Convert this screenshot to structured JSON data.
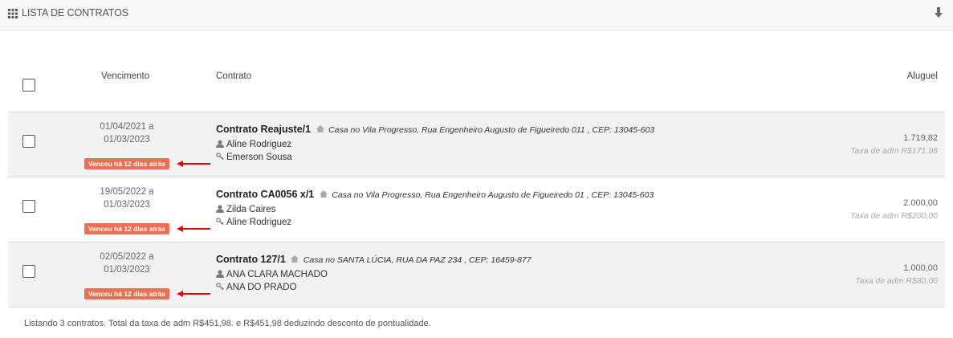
{
  "panel": {
    "title": "LISTA DE CONTRATOS",
    "title_icon": "grid-icon",
    "download_icon": "download-arrow-icon"
  },
  "table": {
    "headers": {
      "vencimento": "Vencimento",
      "contrato": "Contrato",
      "aluguel": "Aluguel"
    },
    "rows": [
      {
        "date_start": "01/04/2021 a",
        "date_end": "01/03/2023",
        "badge": "Venceu há 12 dias atrás",
        "title": "Contrato Reajuste/1",
        "address": "Casa no Vila Progresso, Rua Engenheiro Augusto de Figueiredo 011 , CEP: 13045-603",
        "owner": "Aline Rodriguez",
        "tenant": "Emerson Sousa",
        "valor": "1.719,82",
        "taxa": "Taxa de adm R$171,98"
      },
      {
        "date_start": "19/05/2022 a",
        "date_end": "01/03/2023",
        "badge": "Venceu há 12 dias atrás",
        "title": "Contrato CA0056 x/1",
        "address": "Casa no Vila Progresso, Rua Engenheiro Augusto de Figueiredo 01 , CEP: 13045-603",
        "owner": "Zilda Caires",
        "tenant": "Aline Rodriguez",
        "valor": "2.000,00",
        "taxa": "Taxa de adm R$200,00"
      },
      {
        "date_start": "02/05/2022 a",
        "date_end": "01/03/2023",
        "badge": "Venceu há 12 dias atrás",
        "title": "Contrato 127/1",
        "address": "Casa no SANTA LÚCIA, RUA DA PAZ 234 , CEP: 16459-877",
        "owner": "ANA CLARA MACHADO",
        "tenant": "ANA DO PRADO",
        "valor": "1.000,00",
        "taxa": "Taxa de adm R$80,00"
      }
    ]
  },
  "footer": "Listando 3 contratos. Total da taxa de adm R$451,98. e R$451,98 deduzindo desconto de pontualidade.",
  "colors": {
    "badge": "#ef6f55",
    "arrow": "#e8000b",
    "row_alt": "#f2f2f2"
  }
}
